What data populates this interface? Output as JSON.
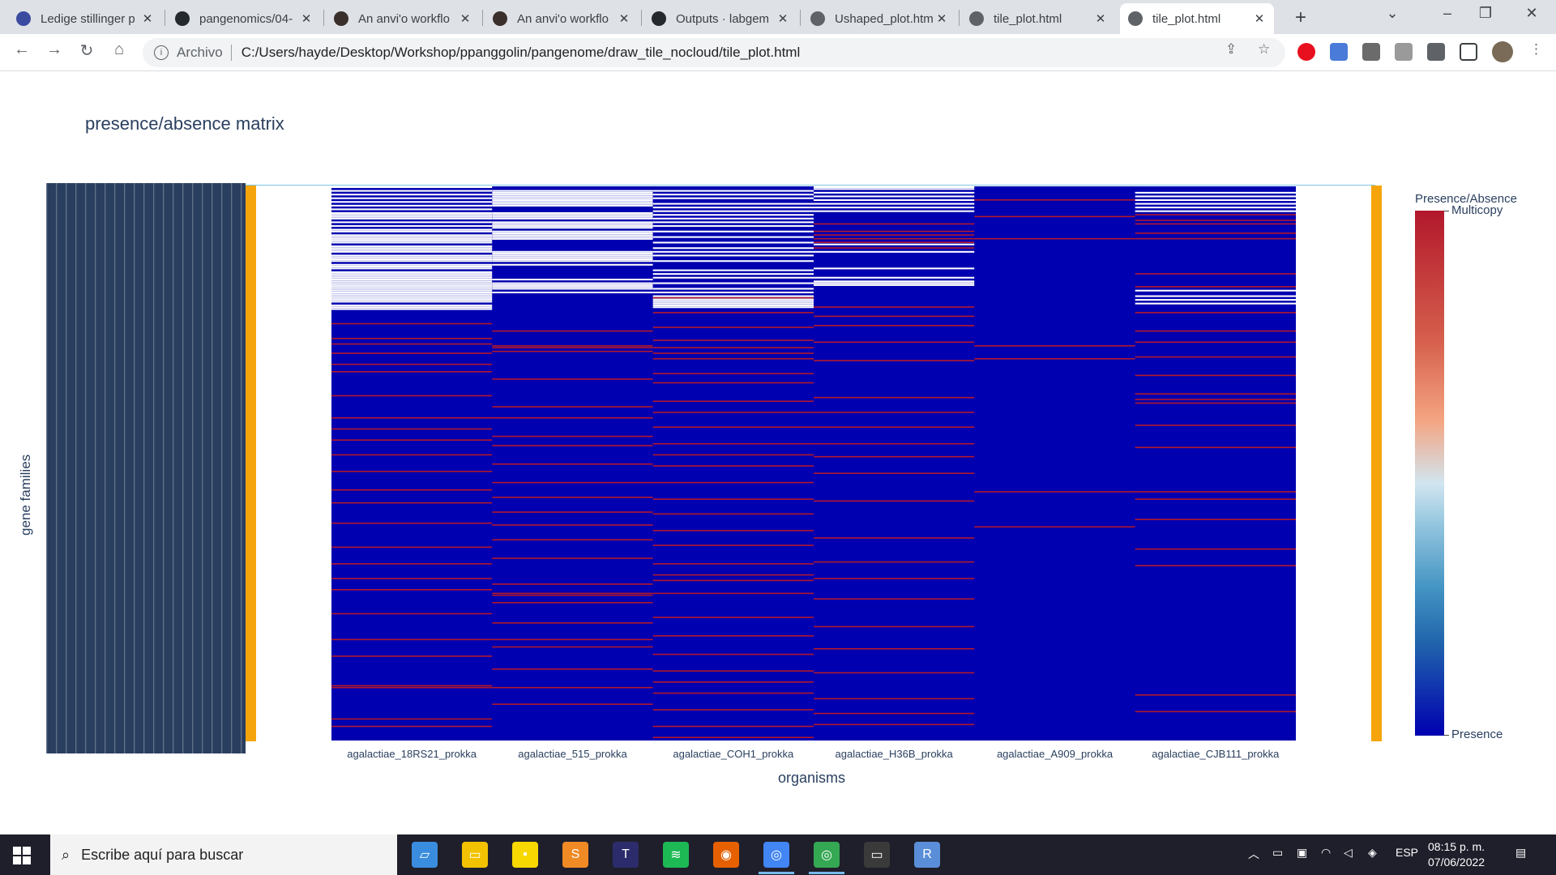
{
  "browser": {
    "tabs": [
      {
        "label": "Ledige stillinger p",
        "icon": "anvio-favicon-icon",
        "color": "#3b4ba0"
      },
      {
        "label": "pangenomics/04-",
        "icon": "github-icon",
        "color": "#24292e"
      },
      {
        "label": "An anvi'o workflo",
        "icon": "anvio-cat-icon",
        "color": "#3a2f2a"
      },
      {
        "label": "An anvi'o workflo",
        "icon": "anvio-cat-icon",
        "color": "#3a2f2a"
      },
      {
        "label": "Outputs · labgem",
        "icon": "github-icon",
        "color": "#24292e"
      },
      {
        "label": "Ushaped_plot.htm",
        "icon": "globe-icon",
        "color": "#5f6368"
      },
      {
        "label": "tile_plot.html",
        "icon": "globe-icon",
        "color": "#5f6368"
      },
      {
        "label": "tile_plot.html",
        "icon": "globe-icon",
        "color": "#5f6368"
      }
    ],
    "active_tab": 7,
    "close_glyph": "✕",
    "new_tab_glyph": "+",
    "address_scheme": "Archivo",
    "address_path": "C:/Users/hayde/Desktop/Workshop/ppanggolin/pangenome/draw_tile_nocloud/tile_plot.html"
  },
  "page": {
    "title": "presence/absence matrix",
    "y_axis_label": "gene families",
    "x_axis_label": "organisms",
    "colorbar_title": "Presence/Absence",
    "colorbar_top_label": "Multicopy",
    "colorbar_bottom_label": "Presence",
    "row_label_prefix": "agal"
  },
  "chart_data": {
    "type": "heatmap",
    "title": "presence/absence matrix",
    "xlabel": "organisms",
    "ylabel": "gene families",
    "categories": [
      "agalactiae_18RS21_prokka",
      "agalactiae_515_prokka",
      "agalactiae_COH1_prokka",
      "agalactiae_H36B_prokka",
      "agalactiae_A909_prokka",
      "agalactiae_CJB111_prokka"
    ],
    "colorscale": {
      "title": "Presence/Absence",
      "max_label": "Multicopy",
      "min_label": "Presence",
      "max_color": "#b2182b",
      "min_color": "#0000b0",
      "absence_color": "#ffffff"
    },
    "n_gene_families": 300,
    "absent_rows": {
      "agalactiae_18RS21_prokka": [
        0,
        2,
        4,
        6,
        8,
        10,
        12,
        14,
        15,
        16,
        17,
        19,
        21,
        23,
        24,
        26,
        27,
        28,
        29,
        30,
        32,
        33,
        34,
        35,
        37,
        38,
        39,
        40,
        42,
        43,
        44,
        46,
        47,
        48,
        49,
        50,
        51,
        52,
        53,
        54,
        55,
        56,
        57,
        58,
        59,
        60,
        61,
        62,
        64,
        65,
        66
      ],
      "agalactiae_515_prokka": [
        2,
        3,
        4,
        5,
        6,
        7,
        8,
        9,
        10,
        14,
        15,
        16,
        17,
        19,
        20,
        21,
        22,
        24,
        25,
        26,
        27,
        28,
        35,
        36,
        37,
        38,
        39,
        40,
        42,
        50,
        52,
        53,
        54,
        55,
        57
      ],
      "agalactiae_COH1_prokka": [
        2,
        4,
        6,
        9,
        11,
        13,
        15,
        17,
        19,
        21,
        24,
        27,
        30,
        33,
        35,
        37,
        40,
        45,
        47,
        49,
        52,
        55,
        57,
        59,
        60,
        61,
        62,
        63,
        64,
        65
      ],
      "agalactiae_H36B_prokka": [
        0,
        1,
        3,
        5,
        7,
        9,
        11,
        13,
        31,
        35,
        44,
        49,
        51,
        52,
        53
      ],
      "agalactiae_A909_prokka": [],
      "agalactiae_CJB111_prokka": [
        3,
        5,
        7,
        9,
        11,
        13,
        56,
        59,
        61,
        63
      ]
    },
    "multicopy_rows": {
      "agalactiae_18RS21_prokka": [
        74,
        82,
        85,
        90,
        96,
        100,
        113,
        125,
        131,
        137,
        145,
        154,
        164,
        171,
        182,
        195,
        204,
        212,
        218,
        231,
        245,
        254,
        270,
        271,
        288,
        292
      ],
      "agalactiae_515_prokka": [
        78,
        86,
        87,
        89,
        104,
        119,
        125,
        135,
        140,
        150,
        160,
        168,
        176,
        183,
        191,
        201,
        215,
        220,
        221,
        225,
        236,
        245,
        249,
        261,
        271,
        280
      ],
      "agalactiae_COH1_prokka": [
        60,
        68,
        76,
        83,
        87,
        90,
        93,
        101,
        106,
        116,
        122,
        130,
        139,
        145,
        151,
        160,
        169,
        177,
        186,
        194,
        204,
        210,
        213,
        220,
        233,
        243,
        253,
        262,
        268,
        274,
        283,
        292,
        298
      ],
      "agalactiae_H36B_prokka": [
        20,
        24,
        26,
        28,
        30,
        33,
        65,
        70,
        75,
        84,
        94,
        114,
        122,
        130,
        139,
        146,
        155,
        170,
        190,
        203,
        212,
        223,
        238,
        250,
        263,
        277,
        285,
        291
      ],
      "agalactiae_A909_prokka": [
        7,
        16,
        28,
        86,
        93,
        165,
        184
      ],
      "agalactiae_CJB111_prokka": [
        15,
        18,
        20,
        25,
        28,
        47,
        54,
        68,
        78,
        84,
        92,
        102,
        112,
        115,
        117,
        129,
        141,
        165,
        169,
        180,
        196,
        205,
        275,
        284
      ]
    }
  },
  "taskbar": {
    "search_placeholder": "Escribe aquí para buscar",
    "language": "ESP",
    "time": "08:15 p. m.",
    "date": "07/06/2022",
    "apps": [
      {
        "name": "notepad-icon",
        "color": "#3a8dde",
        "glyph": "▱"
      },
      {
        "name": "file-explorer-icon",
        "color": "#f2c200",
        "glyph": "▭"
      },
      {
        "name": "sticky-notes-icon",
        "color": "#f7d800",
        "glyph": "▪"
      },
      {
        "name": "sublime-text-icon",
        "color": "#f08a24",
        "glyph": "S"
      },
      {
        "name": "texstudio-icon",
        "color": "#2c2c6c",
        "glyph": "T"
      },
      {
        "name": "spotify-icon",
        "color": "#1db954",
        "glyph": "≋"
      },
      {
        "name": "firefox-icon",
        "color": "#e66000",
        "glyph": "◉"
      },
      {
        "name": "chrome-icon",
        "color": "#4285f4",
        "glyph": "◎"
      },
      {
        "name": "chrome-profile-icon",
        "color": "#34a853",
        "glyph": "◎"
      },
      {
        "name": "terminal-icon",
        "color": "#3a3a3a",
        "glyph": "▭"
      },
      {
        "name": "r-icon",
        "color": "#5a8ed8",
        "glyph": "R"
      }
    ]
  }
}
